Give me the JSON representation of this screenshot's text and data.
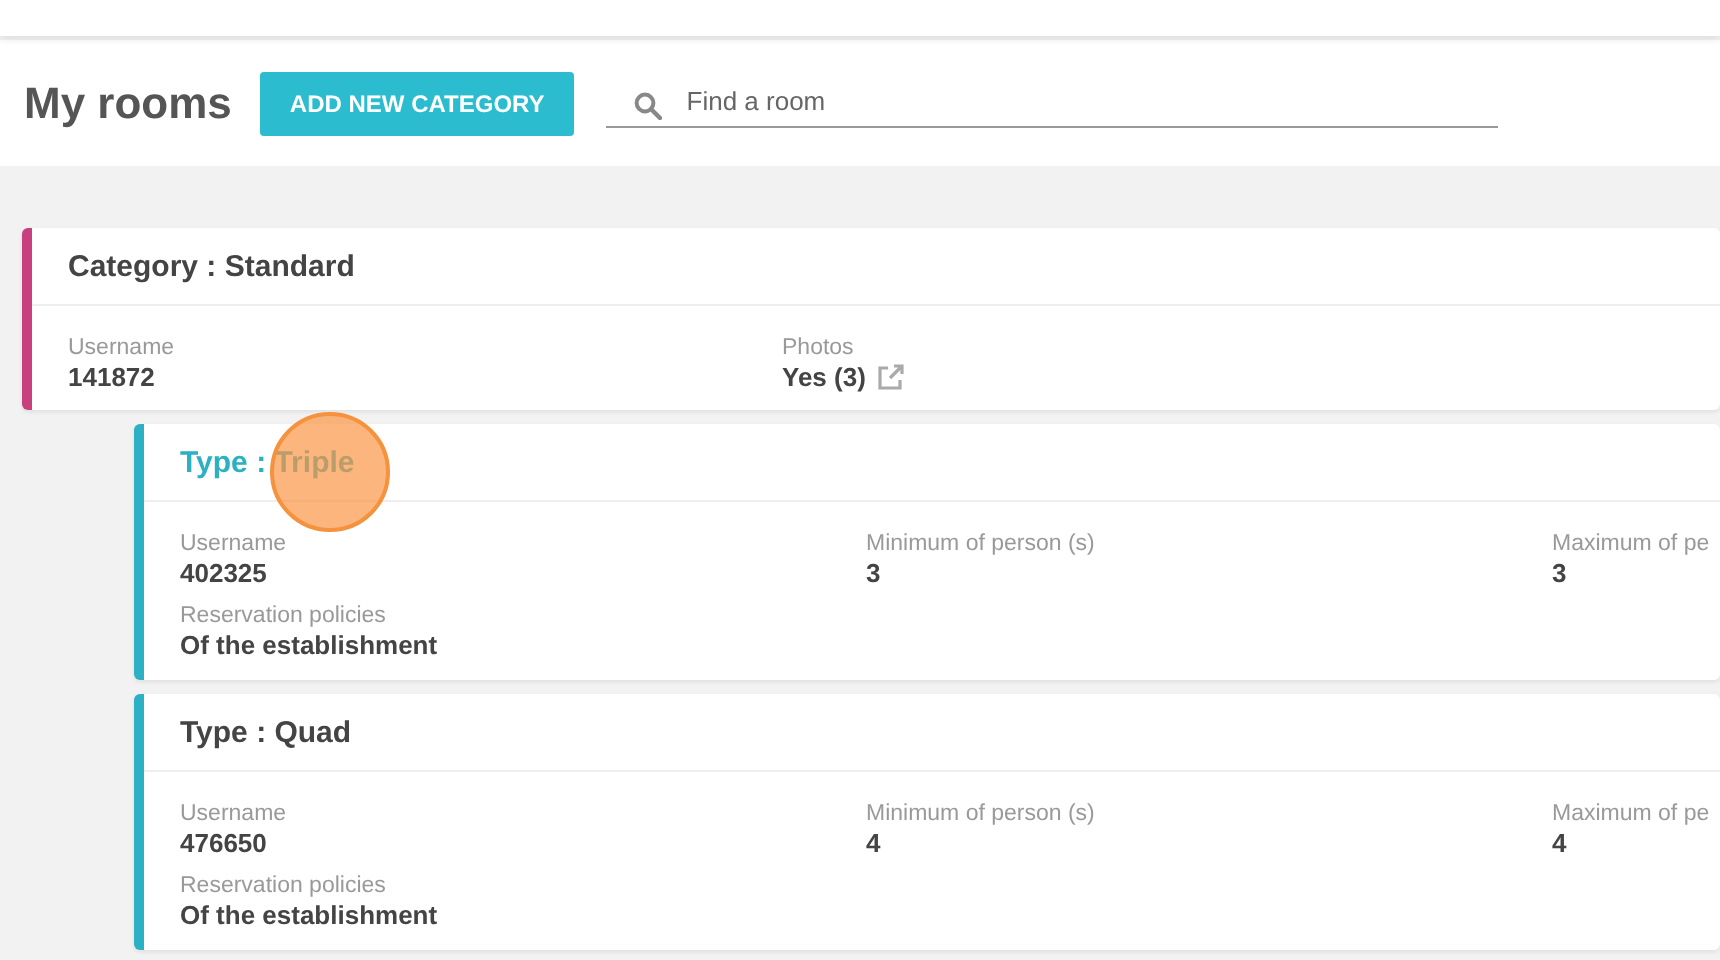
{
  "page_title": "My rooms",
  "add_button": "ADD NEW CATEGORY",
  "search": {
    "placeholder": "Find a room"
  },
  "category": {
    "title": "Category : Standard",
    "fields": [
      {
        "label": "Username",
        "value": "141872",
        "kind": "text"
      },
      {
        "label": "Photos",
        "value": "Yes (3)",
        "kind": "link"
      }
    ]
  },
  "types": [
    {
      "title": "Type : Triple",
      "highlighted": true,
      "click_marker": true,
      "fields": [
        {
          "label": "Username",
          "value": "402325"
        },
        {
          "label": "Minimum of person (s)",
          "value": "3"
        },
        {
          "label": "Maximum of pe",
          "value": "3"
        },
        {
          "label": "Reservation policies",
          "value": "Of the establishment"
        }
      ]
    },
    {
      "title": "Type : Quad",
      "highlighted": false,
      "click_marker": false,
      "fields": [
        {
          "label": "Username",
          "value": "476650"
        },
        {
          "label": "Minimum of person (s)",
          "value": "4"
        },
        {
          "label": "Maximum of pe",
          "value": "4"
        },
        {
          "label": "Reservation policies",
          "value": "Of the establishment"
        }
      ]
    }
  ]
}
